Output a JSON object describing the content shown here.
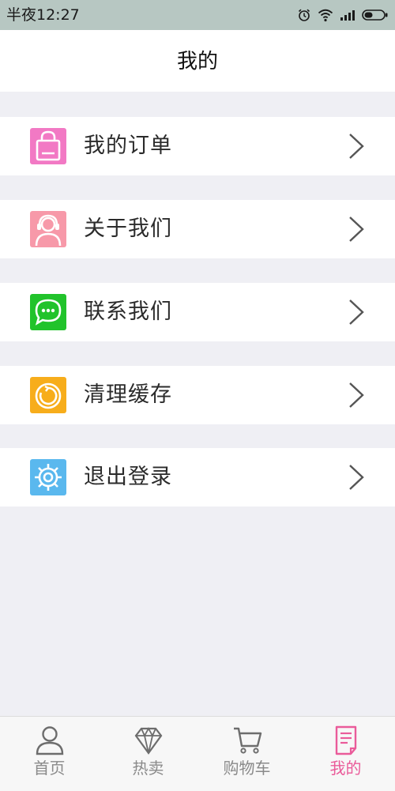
{
  "status_bar": {
    "time": "半夜12:27",
    "icons": [
      "alarm-icon",
      "wifi-icon",
      "signal-icon",
      "battery-icon"
    ]
  },
  "header": {
    "title": "我的"
  },
  "menu": {
    "items": [
      {
        "label": "我的订单",
        "icon": "bag-icon",
        "color": "#f279c4"
      },
      {
        "label": "关于我们",
        "icon": "customer-service-icon",
        "color": "#f799a9"
      },
      {
        "label": "联系我们",
        "icon": "chat-icon",
        "color": "#21c32b"
      },
      {
        "label": "清理缓存",
        "icon": "clean-icon",
        "color": "#f7ad1b"
      },
      {
        "label": "退出登录",
        "icon": "settings-icon",
        "color": "#5ab8ee"
      }
    ],
    "chevron_icon": "chevron-right-icon"
  },
  "tab_bar": {
    "tabs": [
      {
        "label": "首页",
        "icon": "person-icon",
        "active": false
      },
      {
        "label": "热卖",
        "icon": "diamond-icon",
        "active": false
      },
      {
        "label": "购物车",
        "icon": "cart-icon",
        "active": false
      },
      {
        "label": "我的",
        "icon": "document-icon",
        "active": true
      }
    ],
    "active_color": "#ea5b9a",
    "inactive_color": "#8a8a8a"
  }
}
